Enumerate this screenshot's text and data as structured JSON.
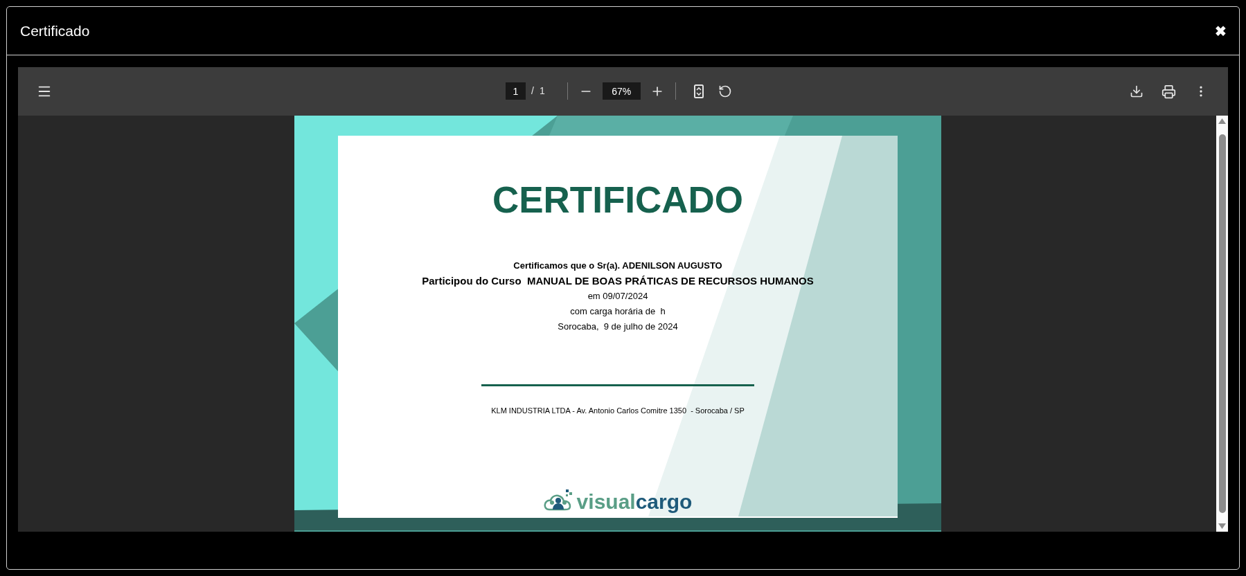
{
  "dialog": {
    "title": "Certificado",
    "close": "✖"
  },
  "viewer": {
    "page_input": "1",
    "page_separator": "/",
    "page_total": "1",
    "zoom": "67%"
  },
  "certificate": {
    "heading": "CERTIFICADO",
    "lines": [
      {
        "kind": "bold",
        "text": "Certificamos que o Sr(a). ADENILSON AUGUSTO"
      },
      {
        "kind": "large",
        "text": "Participou do Curso  MANUAL DE BOAS PRÁTICAS DE RECURSOS HUMANOS"
      },
      {
        "kind": "plain",
        "text": "em 09/07/2024"
      },
      {
        "kind": "plain",
        "text": "com carga horária de  h"
      },
      {
        "kind": "plain",
        "text": "Sorocaba,  9 de julho de 2024"
      }
    ],
    "footer": "KLM INDUSTRIA LTDA - Av. Antonio Carlos Comitre 1350  - Sorocaba / SP",
    "logo": {
      "first": "visual",
      "second": "cargo"
    }
  }
}
